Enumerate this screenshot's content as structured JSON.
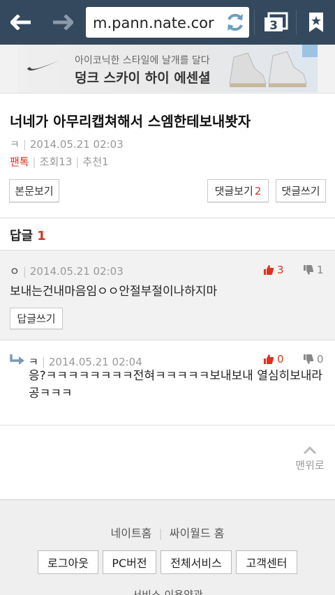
{
  "browser": {
    "url": "m.pann.nate.cor",
    "tab_count": "3"
  },
  "ad": {
    "line1": "아이코닉한 스타일에 날개를 달다",
    "line2": "덩크 스카이 하이 에센셜"
  },
  "article": {
    "title": "너네가 아무리캡쳐해서 스엠한테보내봣자",
    "author": "ㅋ",
    "date": "2014.05.21 02:03",
    "category": "팬톡",
    "views": "조회13",
    "recommends": "추천1",
    "view_body_label": "본문보기",
    "view_comments_label": "댓글보기",
    "comment_count": "2",
    "write_comment_label": "댓글쓰기"
  },
  "replies": {
    "label": "답글",
    "count": "1"
  },
  "comments": [
    {
      "author": "ㅇ",
      "date": "2014.05.21 02:03",
      "body": "보내는건내마음임ㅇㅇ안절부절이나하지마",
      "likes": "3",
      "dislikes": "1",
      "reply_label": "답글쓰기"
    },
    {
      "author": "ㅋ",
      "date": "2014.05.21 02:04",
      "body": "응?ㅋㅋㅋㅋㅋㅋㅋㅋ전혀ㅋㅋㅋㅋㅋ보내보내 열심히보내라공ㅋㅋㅋ",
      "likes": "0",
      "dislikes": "0"
    }
  ],
  "scroll_top_label": "맨위로",
  "footer": {
    "nate_home": "네이트홈",
    "cyworld_home": "싸이월드 홈",
    "logout": "로그아웃",
    "pc_version": "PC버전",
    "all_services": "전체서비스",
    "customer_center": "고객센터",
    "terms": "서비스 이용약관"
  },
  "colors": {
    "toolbar": "#34495e",
    "accent_red": "#e0301e"
  }
}
